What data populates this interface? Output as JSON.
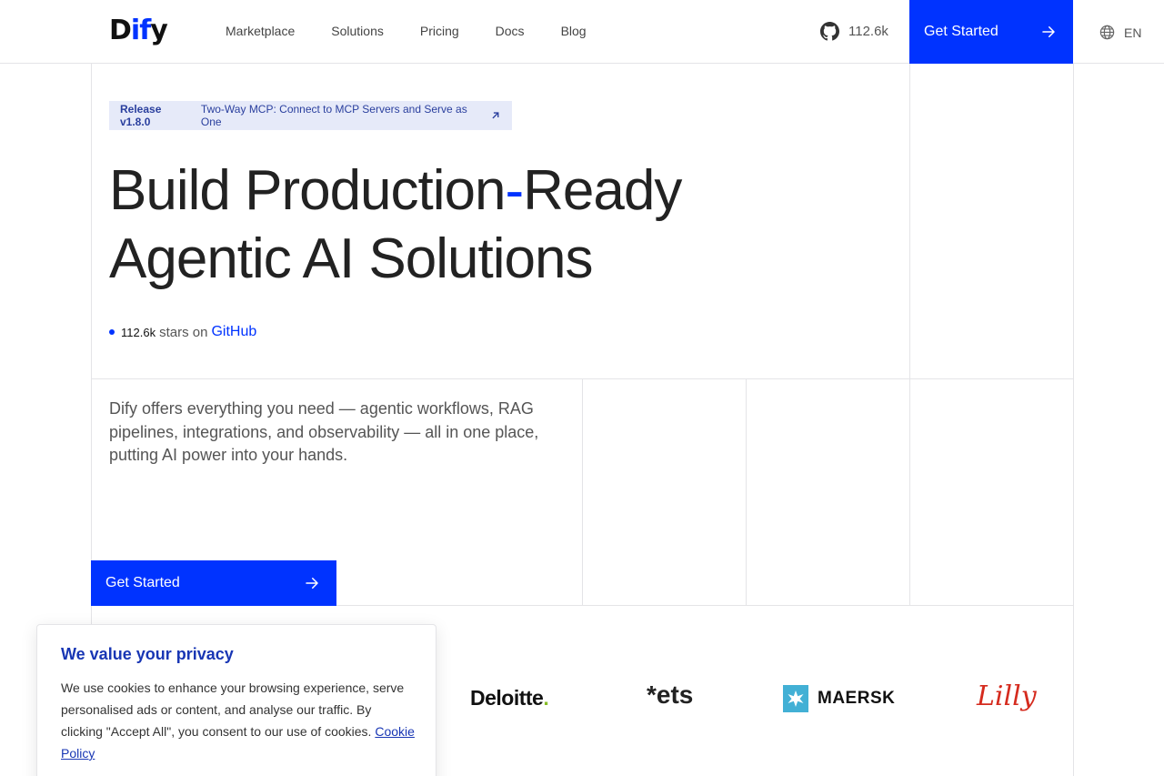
{
  "header": {
    "logo_plain_1": "D",
    "logo_blue": "if",
    "logo_plain_2": "y",
    "nav": [
      "Marketplace",
      "Solutions",
      "Pricing",
      "Docs",
      "Blog"
    ],
    "github_stars": "112.6k",
    "cta_label": "Get Started",
    "language": "EN"
  },
  "release": {
    "version": "Release v1.8.0",
    "text": "Two-Way MCP: Connect to MCP Servers and Serve as One"
  },
  "hero": {
    "line1_a": "Build Production",
    "line1_dash": "-",
    "line1_b": "Ready",
    "line2": "Agentic AI Solutions",
    "stars_count": "112.6k",
    "stars_text": "stars on",
    "stars_link": "GitHub",
    "description": "Dify offers everything you need — agentic workflows, RAG pipelines, integrations, and observability — all in one place, putting AI power into your hands.",
    "cta_label": "Get Started"
  },
  "logos": {
    "deloitte": "Deloitte",
    "deloitte_dot": ".",
    "ets": "*ets",
    "maersk": "MAERSK",
    "lilly": "Lilly"
  },
  "cookie": {
    "title": "We value your privacy",
    "body": "We use cookies to enhance your browsing experience, serve personalised ads or content, and analyse our traffic. By clicking \"Accept All\", you consent to our use of cookies.",
    "link": "Cookie Policy"
  },
  "colors": {
    "brand_blue": "#0033ff",
    "badge_bg": "#e6eaf9",
    "cookie_title": "#1836b4"
  }
}
